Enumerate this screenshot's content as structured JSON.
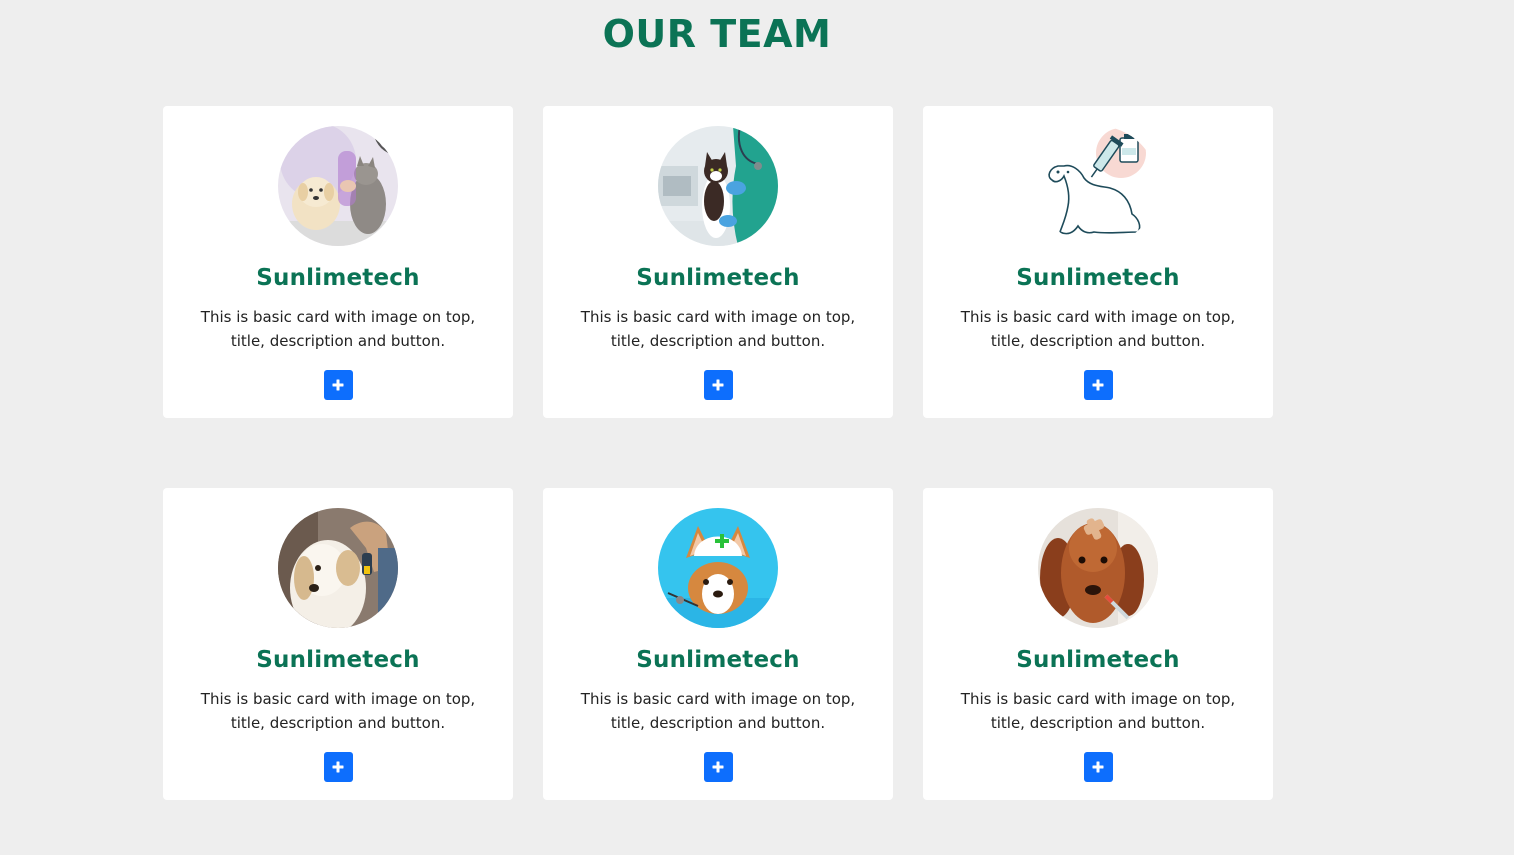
{
  "page": {
    "title": "OUR TEAM"
  },
  "colors": {
    "title": "#0b7355",
    "button": "#0d6efd",
    "background": "#eeeeee",
    "card": "#ffffff"
  },
  "cards": [
    {
      "title": "Sunlimetech",
      "description": "This is basic card with image on top, title, description and button.",
      "image": "dog-and-cat-with-vet-photo",
      "button_icon": "plus-icon"
    },
    {
      "title": "Sunlimetech",
      "description": "This is basic card with image on top, title, description and button.",
      "image": "vet-holding-cat-photo",
      "button_icon": "plus-icon"
    },
    {
      "title": "Sunlimetech",
      "description": "This is basic card with image on top, title, description and button.",
      "image": "dog-vaccine-illustration",
      "button_icon": "plus-icon"
    },
    {
      "title": "Sunlimetech",
      "description": "This is basic card with image on top, title, description and button.",
      "image": "dog-ear-exam-photo",
      "button_icon": "plus-icon"
    },
    {
      "title": "Sunlimetech",
      "description": "This is basic card with image on top, title, description and button.",
      "image": "corgi-nurse-cap-photo",
      "button_icon": "plus-icon"
    },
    {
      "title": "Sunlimetech",
      "description": "This is basic card with image on top, title, description and button.",
      "image": "dachshund-thermometer-photo",
      "button_icon": "plus-icon"
    }
  ]
}
